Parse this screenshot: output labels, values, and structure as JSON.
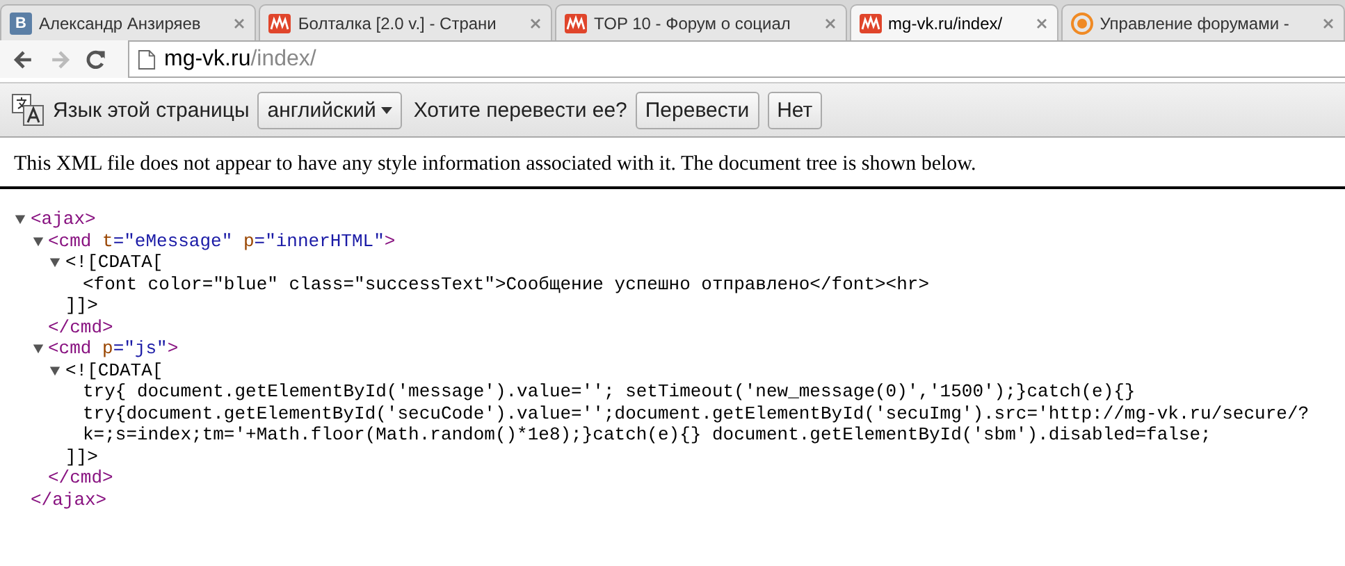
{
  "tabs": [
    {
      "kind": "vk",
      "badge": "В",
      "title": "Александр Анзиряев",
      "selected": false
    },
    {
      "kind": "forum",
      "title": "Болталка [2.0 v.] - Страни",
      "selected": false
    },
    {
      "kind": "forum",
      "title": "TOP 10 - Форум о социал",
      "selected": false
    },
    {
      "kind": "forum",
      "title": "mg-vk.ru/index/",
      "selected": true
    },
    {
      "kind": "target",
      "title": "Управление форумами -",
      "selected": false
    }
  ],
  "toolbar": {
    "back_disabled": false,
    "forward_disabled": true,
    "address_host": "mg-vk.ru",
    "address_path": "/index/"
  },
  "translate_bar": {
    "label": "Язык этой страницы",
    "language": "английский",
    "question": "Хотите перевести ее?",
    "buttons": [
      "Перевести",
      "Нет"
    ]
  },
  "notice": "This XML file does not appear to have any style information associated with it. The document tree is shown below.",
  "xml_tree": [
    {
      "kind": "element",
      "expanded": true,
      "open": [
        {
          "kind": "tag",
          "text": "<ajax>"
        }
      ],
      "close": [
        {
          "kind": "tag",
          "text": "</ajax>"
        }
      ],
      "children": [
        {
          "kind": "element",
          "expanded": true,
          "open": [
            {
              "kind": "tag",
              "text": "<cmd"
            },
            {
              "kind": "attr",
              "text": " t"
            },
            {
              "kind": "value",
              "text": "=\"eMessage\""
            },
            {
              "kind": "attr",
              "text": " p"
            },
            {
              "kind": "value",
              "text": "=\"innerHTML\""
            },
            {
              "kind": "tag",
              "text": ">"
            }
          ],
          "close": [
            {
              "kind": "tag",
              "text": "</cmd>"
            }
          ],
          "children": [
            {
              "kind": "cdata",
              "expanded": true,
              "open": "<![CDATA[",
              "close": "]]>",
              "lines": [
                "<font color=\"blue\" class=\"successText\">Сообщение успешно отправлено</font><hr>"
              ]
            }
          ]
        },
        {
          "kind": "element",
          "expanded": true,
          "open": [
            {
              "kind": "tag",
              "text": "<cmd"
            },
            {
              "kind": "attr",
              "text": " p"
            },
            {
              "kind": "value",
              "text": "=\"js\""
            },
            {
              "kind": "tag",
              "text": ">"
            }
          ],
          "close": [
            {
              "kind": "tag",
              "text": "</cmd>"
            }
          ],
          "children": [
            {
              "kind": "cdata",
              "expanded": true,
              "open": "<![CDATA[",
              "close": "]]>",
              "lines": [
                "try{ document.getElementById('message').value=''; setTimeout('new_message(0)','1500');}catch(e){}",
                "try{document.getElementById('secuCode').value='';document.getElementById('secuImg').src='http://mg-vk.ru/secure/?",
                "k=;s=index;tm='+Math.floor(Math.random()*1e8);}catch(e){} document.getElementById('sbm').disabled=false;"
              ]
            }
          ]
        }
      ]
    }
  ]
}
